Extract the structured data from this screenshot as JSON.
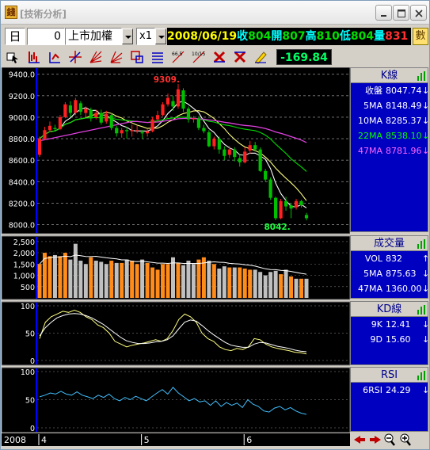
{
  "window": {
    "title": "[技術分析]",
    "app_icon_glyph": "錢"
  },
  "toolbar": {
    "period": "日",
    "stock_code": "0",
    "stock_name": "上市加權",
    "zoom": "x1",
    "quote": {
      "date": "2008/06/19",
      "close_label": "收",
      "close": "804",
      "open_label": "開",
      "open": "807",
      "high_label": "高",
      "high": "810",
      "low_label": "低",
      "low": "804",
      "vol_label": "量",
      "vol": "831"
    },
    "settings_glyph": "數",
    "change": "-169.84",
    "tool_icons": [
      "pointer-icon",
      "kline-icon",
      "bar-icon",
      "crosshair-icon",
      "fan-icon",
      "fan2-icon",
      "zoom-box-icon",
      "lines-icon",
      "ma-66-5-icon",
      "ma-10-15-icon",
      "delete-icon",
      "close-icon",
      "pencil-icon",
      "flag-icon"
    ],
    "tool_texts": {
      "ma1": "66.5",
      "ma2": "10/15"
    }
  },
  "chart_data": [
    {
      "type": "candlestick",
      "name": "K線",
      "yticks": [
        "9400.0",
        "9200.0",
        "9000.0",
        "8800.0",
        "8600.0",
        "8400.0",
        "8200.0",
        "8000.0"
      ],
      "ylim": [
        7960,
        9420
      ],
      "annotations": {
        "high": "9309.",
        "low": "8042."
      },
      "ma_lines": [
        {
          "name": "5MA",
          "color": "#ffffff"
        },
        {
          "name": "10MA",
          "color": "#ffff80"
        },
        {
          "name": "22MA",
          "color": "#00e000"
        },
        {
          "name": "47MA",
          "color": "#e040e0"
        }
      ],
      "candles": [
        {
          "o": 8650,
          "c": 8800,
          "h": 8820,
          "l": 8630
        },
        {
          "o": 8800,
          "c": 8880,
          "h": 8910,
          "l": 8790
        },
        {
          "o": 8880,
          "c": 8920,
          "h": 8960,
          "l": 8860
        },
        {
          "o": 8900,
          "c": 8890,
          "h": 8930,
          "l": 8870
        },
        {
          "o": 8890,
          "c": 9000,
          "h": 9020,
          "l": 8880
        },
        {
          "o": 9000,
          "c": 9120,
          "h": 9140,
          "l": 8990
        },
        {
          "o": 9110,
          "c": 9040,
          "h": 9150,
          "l": 9000
        },
        {
          "o": 9040,
          "c": 9160,
          "h": 9180,
          "l": 9020
        },
        {
          "o": 9130,
          "c": 9050,
          "h": 9150,
          "l": 9020
        },
        {
          "o": 9040,
          "c": 9080,
          "h": 9100,
          "l": 9000
        },
        {
          "o": 9070,
          "c": 8990,
          "h": 9090,
          "l": 8960
        },
        {
          "o": 9000,
          "c": 9040,
          "h": 9070,
          "l": 8980
        },
        {
          "o": 9040,
          "c": 8950,
          "h": 9070,
          "l": 8930
        },
        {
          "o": 8960,
          "c": 9030,
          "h": 9060,
          "l": 8940
        },
        {
          "o": 9020,
          "c": 8900,
          "h": 9040,
          "l": 8880
        },
        {
          "o": 8900,
          "c": 8850,
          "h": 8920,
          "l": 8820
        },
        {
          "o": 8850,
          "c": 8880,
          "h": 8900,
          "l": 8810
        },
        {
          "o": 8880,
          "c": 8870,
          "h": 8910,
          "l": 8800
        },
        {
          "o": 8870,
          "c": 8880,
          "h": 8930,
          "l": 8820
        },
        {
          "o": 8880,
          "c": 8880,
          "h": 8920,
          "l": 8850
        },
        {
          "o": 8860,
          "c": 8850,
          "h": 8880,
          "l": 8800
        },
        {
          "o": 8850,
          "c": 8870,
          "h": 8890,
          "l": 8820
        },
        {
          "o": 8870,
          "c": 8980,
          "h": 9000,
          "l": 8860
        },
        {
          "o": 8980,
          "c": 9020,
          "h": 9060,
          "l": 8960
        },
        {
          "o": 9020,
          "c": 9120,
          "h": 9140,
          "l": 9010
        },
        {
          "o": 9120,
          "c": 9180,
          "h": 9220,
          "l": 9100
        },
        {
          "o": 9150,
          "c": 9100,
          "h": 9200,
          "l": 9060
        },
        {
          "o": 9100,
          "c": 9260,
          "h": 9309,
          "l": 9080
        },
        {
          "o": 9250,
          "c": 9080,
          "h": 9270,
          "l": 9050
        },
        {
          "o": 9080,
          "c": 8980,
          "h": 9100,
          "l": 8950
        },
        {
          "o": 8980,
          "c": 8990,
          "h": 9010,
          "l": 8950
        },
        {
          "o": 8990,
          "c": 8900,
          "h": 9010,
          "l": 8880
        },
        {
          "o": 8900,
          "c": 8870,
          "h": 8930,
          "l": 8850
        },
        {
          "o": 8860,
          "c": 8730,
          "h": 8880,
          "l": 8720
        },
        {
          "o": 8730,
          "c": 8800,
          "h": 8820,
          "l": 8700
        },
        {
          "o": 8800,
          "c": 8700,
          "h": 8820,
          "l": 8660
        },
        {
          "o": 8700,
          "c": 8640,
          "h": 8730,
          "l": 8600
        },
        {
          "o": 8650,
          "c": 8700,
          "h": 8730,
          "l": 8620
        },
        {
          "o": 8700,
          "c": 8630,
          "h": 8720,
          "l": 8590
        },
        {
          "o": 8620,
          "c": 8580,
          "h": 8660,
          "l": 8540
        },
        {
          "o": 8580,
          "c": 8680,
          "h": 8720,
          "l": 8570
        },
        {
          "o": 8690,
          "c": 8740,
          "h": 8780,
          "l": 8660
        },
        {
          "o": 8740,
          "c": 8700,
          "h": 8770,
          "l": 8680
        },
        {
          "o": 8700,
          "c": 8500,
          "h": 8720,
          "l": 8490
        },
        {
          "o": 8500,
          "c": 8420,
          "h": 8520,
          "l": 8400
        },
        {
          "o": 8420,
          "c": 8250,
          "h": 8440,
          "l": 8230
        },
        {
          "o": 8250,
          "c": 8060,
          "h": 8260,
          "l": 8042
        },
        {
          "o": 8060,
          "c": 8220,
          "h": 8240,
          "l": 8050
        },
        {
          "o": 8220,
          "c": 8170,
          "h": 8260,
          "l": 8130
        },
        {
          "o": 8180,
          "c": 8150,
          "h": 8200,
          "l": 8060
        },
        {
          "o": 8160,
          "c": 8220,
          "h": 8240,
          "l": 8140
        },
        {
          "o": 8220,
          "c": 8180,
          "h": 8230,
          "l": 8160
        },
        {
          "o": 8090,
          "c": 8060,
          "h": 8110,
          "l": 8040
        }
      ]
    },
    {
      "type": "bar",
      "name": "成交量",
      "yticks": [
        "2,500",
        "2,000",
        "1,500",
        "1,000",
        "500"
      ],
      "ylim": [
        0,
        2600
      ],
      "values": [
        1500,
        2000,
        1850,
        1900,
        1850,
        2000,
        1700,
        2400,
        1650,
        1500,
        1800,
        1650,
        1600,
        1500,
        1650,
        1550,
        1550,
        1700,
        1650,
        1500,
        1700,
        1550,
        1350,
        1250,
        1500,
        1500,
        1800,
        1550,
        1450,
        1650,
        1500,
        1700,
        1800,
        1650,
        1500,
        1300,
        1400,
        1350,
        1350,
        1350,
        1300,
        1250,
        1250,
        1150,
        1000,
        1150,
        1200,
        1050,
        1250,
        950,
        850,
        850,
        850
      ],
      "colors": [
        "o",
        "o",
        "o",
        "g",
        "o",
        "o",
        "g",
        "g",
        "g",
        "g",
        "o",
        "g",
        "g",
        "g",
        "o",
        "g",
        "o",
        "g",
        "o",
        "o",
        "g",
        "o",
        "o",
        "o",
        "o",
        "o",
        "g",
        "o",
        "g",
        "g",
        "g",
        "o",
        "o",
        "g",
        "o",
        "g",
        "g",
        "o",
        "g",
        "o",
        "o",
        "o",
        "g",
        "g",
        "g",
        "g",
        "g",
        "o",
        "g",
        "o",
        "g",
        "o",
        "g"
      ]
    },
    {
      "type": "line",
      "name": "KD線",
      "yticks": [
        "100",
        "50",
        "0"
      ],
      "ylim": [
        0,
        100
      ],
      "series": [
        {
          "name": "9K",
          "color": "#ffff80",
          "values": [
            40,
            70,
            80,
            85,
            90,
            88,
            92,
            88,
            80,
            75,
            65,
            60,
            50,
            35,
            30,
            25,
            28,
            30,
            32,
            35,
            38,
            35,
            40,
            55,
            75,
            85,
            80,
            70,
            50,
            40,
            35,
            25,
            20,
            18,
            22,
            20,
            25,
            40,
            38,
            30,
            25,
            22,
            20,
            18,
            15,
            14,
            12
          ]
        },
        {
          "name": "9D",
          "color": "#ffffff",
          "values": [
            45,
            60,
            70,
            78,
            82,
            85,
            86,
            85,
            82,
            78,
            72,
            66,
            58,
            50,
            42,
            36,
            33,
            31,
            31,
            32,
            34,
            35,
            38,
            45,
            58,
            70,
            74,
            72,
            64,
            55,
            47,
            40,
            33,
            28,
            26,
            24,
            24,
            30,
            33,
            32,
            29,
            26,
            24,
            22,
            19,
            17,
            16
          ]
        }
      ]
    },
    {
      "type": "line",
      "name": "RSI",
      "yticks": [
        "100",
        "50",
        "0"
      ],
      "ylim": [
        0,
        100
      ],
      "series": [
        {
          "name": "6RSI",
          "color": "#40c0ff",
          "values": [
            55,
            58,
            62,
            60,
            65,
            60,
            58,
            64,
            58,
            55,
            52,
            58,
            54,
            60,
            52,
            48,
            54,
            50,
            56,
            52,
            48,
            55,
            62,
            68,
            60,
            72,
            62,
            55,
            48,
            52,
            46,
            48,
            40,
            48,
            38,
            45,
            40,
            44,
            36,
            50,
            42,
            38,
            30,
            28,
            35,
            38,
            32,
            36,
            30,
            26,
            24
          ]
        }
      ]
    },
    {
      "type": "axis",
      "name": "x-axis",
      "year": "2008",
      "months": [
        "4",
        "5",
        "6"
      ]
    }
  ],
  "panels": {
    "k": {
      "title": "K線",
      "rows": [
        {
          "label": "收盤",
          "value": "8047.74",
          "arrow": "↓",
          "color": "#ffffff"
        },
        {
          "label": "5MA",
          "value": "8148.49",
          "arrow": "↓",
          "color": "#ffffff"
        },
        {
          "label": "10MA",
          "value": "8285.37",
          "arrow": "↓",
          "color": "#ffffff"
        },
        {
          "label": "22MA",
          "value": "8538.10",
          "arrow": "↓",
          "color": "#00ff00"
        },
        {
          "label": "47MA",
          "value": "8781.96",
          "arrow": "↓",
          "color": "#ff66ff"
        }
      ]
    },
    "vol": {
      "title": "成交量",
      "rows": [
        {
          "label": "VOL",
          "value": "832",
          "arrow": "↑",
          "color": "#ffffff"
        },
        {
          "label": "5MA",
          "value": "875.63",
          "arrow": "↓",
          "color": "#ffffff"
        },
        {
          "label": "47MA",
          "value": "1360.00",
          "arrow": "↓",
          "color": "#ffffff"
        }
      ]
    },
    "kd": {
      "title": "KD線",
      "rows": [
        {
          "label": "9K",
          "value": "12.41",
          "arrow": "↓",
          "color": "#ffffff"
        },
        {
          "label": "9D",
          "value": "15.60",
          "arrow": "↓",
          "color": "#ffffff"
        }
      ]
    },
    "rsi": {
      "title": "RSI",
      "rows": [
        {
          "label": "6RSI",
          "value": "24.29",
          "arrow": "↓",
          "color": "#ffffff"
        }
      ]
    }
  },
  "nav": {
    "icons": [
      "scroll-left-icon",
      "scroll-right-icon",
      "zoom-out-icon",
      "zoom-in-icon"
    ]
  }
}
